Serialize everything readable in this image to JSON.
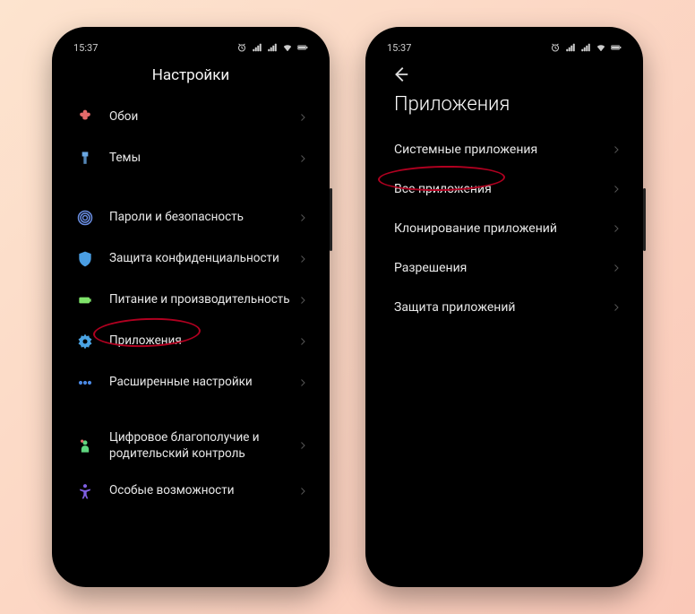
{
  "statusbar": {
    "time": "15:37"
  },
  "phone1": {
    "title": "Настройки",
    "items": [
      {
        "label": "Обои",
        "icon": "flower",
        "color": "#e36a6a"
      },
      {
        "label": "Темы",
        "icon": "brush",
        "color": "#6aa8e3"
      },
      null,
      {
        "label": "Пароли и безопасность",
        "icon": "fingerprint",
        "color": "#6a8ee3"
      },
      {
        "label": "Защита конфиденциальности",
        "icon": "shield",
        "color": "#4a9ee3"
      },
      {
        "label": "Питание и производительность",
        "icon": "battery",
        "color": "#7fe36a"
      },
      {
        "label": "Приложения",
        "icon": "gear",
        "color": "#4aa3e3",
        "highlight": true
      },
      {
        "label": "Расширенные настройки",
        "icon": "dots",
        "color": "#4a88e3"
      },
      null,
      {
        "label": "Цифровое благополучие и родительский контроль",
        "icon": "wellbeing",
        "color": "#5fd67f"
      },
      {
        "label": "Особые возможности",
        "icon": "accessibility",
        "color": "#7f5fe3"
      }
    ]
  },
  "phone2": {
    "title": "Приложения",
    "items": [
      {
        "label": "Системные приложения"
      },
      {
        "label": "Все приложения",
        "highlight": true
      },
      {
        "label": "Клонирование приложений"
      },
      {
        "label": "Разрешения"
      },
      {
        "label": "Защита приложений"
      }
    ]
  }
}
